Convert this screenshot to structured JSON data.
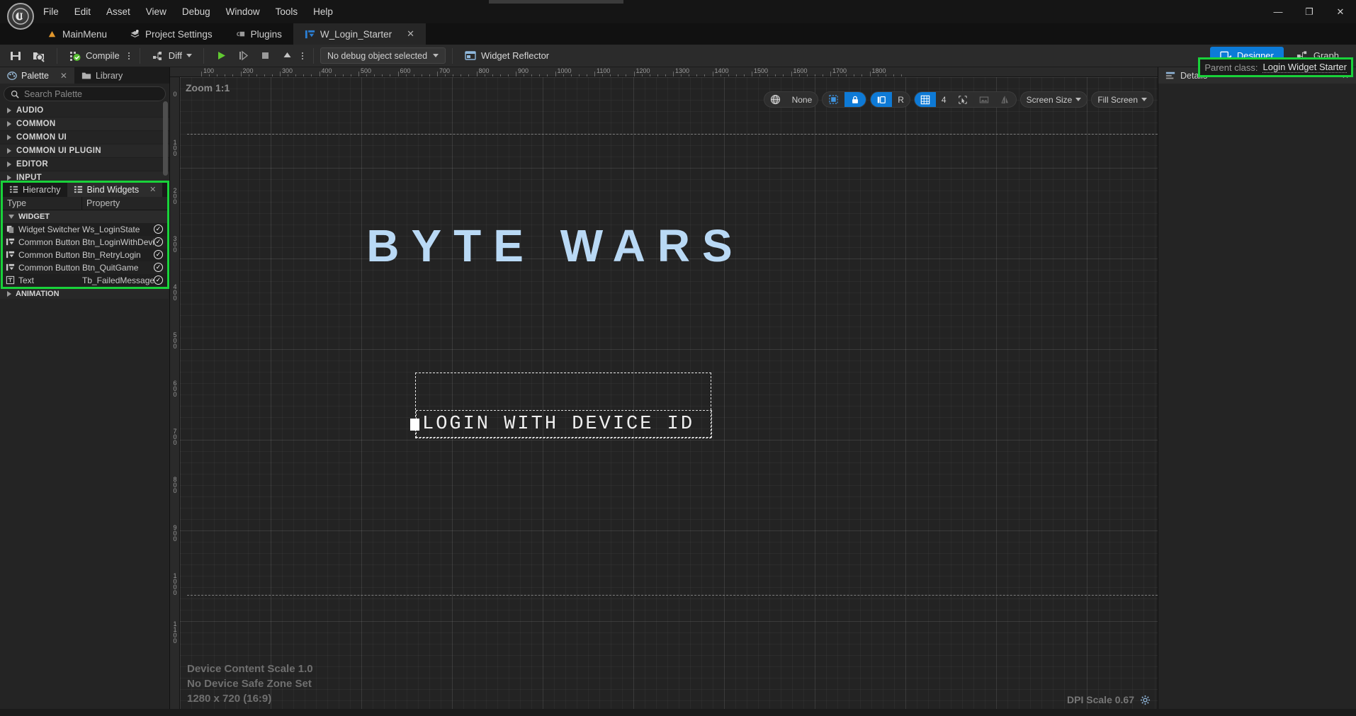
{
  "window": {
    "minimize_label": "—",
    "maximize_label": "❐",
    "close_label": "✕"
  },
  "menubar": {
    "items": [
      {
        "label": "File"
      },
      {
        "label": "Edit"
      },
      {
        "label": "Asset"
      },
      {
        "label": "View"
      },
      {
        "label": "Debug"
      },
      {
        "label": "Window"
      },
      {
        "label": "Tools"
      },
      {
        "label": "Help"
      }
    ]
  },
  "tabs": [
    {
      "label": "MainMenu",
      "icon": "level-icon",
      "active": false,
      "closable": false
    },
    {
      "label": "Project Settings",
      "icon": "settings-icon",
      "active": false,
      "closable": false
    },
    {
      "label": "Plugins",
      "icon": "plugin-icon",
      "active": false,
      "closable": false
    },
    {
      "label": "W_Login_Starter",
      "icon": "widget-blueprint-icon",
      "active": true,
      "closable": true,
      "close_label": "✕"
    }
  ],
  "toolbar": {
    "save_icon": "save-icon",
    "browse_icon": "browse-content-icon",
    "compile_label": "Compile",
    "compile_icon": "compile-icon",
    "diff_label": "Diff",
    "diff_icon": "diff-icon",
    "play_icon": "play-icon",
    "step_icon": "step-icon",
    "stop_icon": "stop-icon",
    "eject_icon": "eject-icon",
    "debug_object_label": "No debug object selected",
    "widget_reflector_label": "Widget Reflector",
    "widget_reflector_icon": "widget-reflector-icon",
    "designer_label": "Designer",
    "designer_icon": "designer-icon",
    "graph_label": "Graph",
    "graph_icon": "graph-icon",
    "accent_color": "#0c7bd8"
  },
  "parent_class": {
    "label": "Parent class:",
    "value": "Login Widget Starter",
    "highlight_color": "#19d23a"
  },
  "palette": {
    "tabs": [
      {
        "label": "Palette",
        "icon": "palette-icon",
        "active": true,
        "close_label": "✕"
      },
      {
        "label": "Library",
        "icon": "folder-icon",
        "active": false
      }
    ],
    "search_placeholder": "Search Palette",
    "search_value": "",
    "categories": [
      {
        "label": "AUDIO"
      },
      {
        "label": "COMMON"
      },
      {
        "label": "COMMON UI"
      },
      {
        "label": "COMMON UI PLUGIN"
      },
      {
        "label": "EDITOR"
      },
      {
        "label": "INPUT"
      }
    ],
    "animation_label": "ANIMATION"
  },
  "bind_widgets": {
    "highlight_color": "#19d23a",
    "tabs": [
      {
        "label": "Hierarchy",
        "icon": "hierarchy-icon",
        "active": false
      },
      {
        "label": "Bind Widgets",
        "icon": "bind-widgets-icon",
        "active": true,
        "close_label": "✕"
      }
    ],
    "columns": {
      "type": "Type",
      "property": "Property"
    },
    "group_label": "WIDGET",
    "rows": [
      {
        "type": "Widget Switcher",
        "property": "Ws_LoginState",
        "icon": "widget-switcher-icon",
        "bound": true,
        "check": "✓"
      },
      {
        "type": "Common Button Ba",
        "property": "Btn_LoginWithDeviceId",
        "icon": "common-button-icon",
        "bound": true,
        "check": "✓"
      },
      {
        "type": "Common Button Ba",
        "property": "Btn_RetryLogin",
        "icon": "common-button-icon",
        "bound": true,
        "check": "✓"
      },
      {
        "type": "Common Button Ba",
        "property": "Btn_QuitGame",
        "icon": "common-button-icon",
        "bound": true,
        "check": "✓"
      },
      {
        "type": "Text",
        "property": "Tb_FailedMessage",
        "icon": "text-icon",
        "bound": true,
        "check": "✓"
      }
    ]
  },
  "viewport": {
    "zoom_label": "Zoom 1:1",
    "ruler_top_ticks": [
      "100",
      "200",
      "300",
      "400",
      "500",
      "600",
      "700",
      "800",
      "900",
      "1000",
      "1100",
      "1200",
      "1300",
      "1400",
      "1500",
      "1600",
      "1700",
      "1800"
    ],
    "ruler_left_ticks": [
      "0",
      "1 0 0",
      "2 0 0",
      "3 0 0",
      "4 0 0",
      "5 0 0",
      "6 0 0",
      "7 0 0",
      "8 0 0",
      "9 0 0",
      "1 0 0 0",
      "1 1 0 0"
    ],
    "logo_text": "BYTE WARS",
    "selected_button_text": "LOGIN WITH DEVICE ID",
    "footer_lines": [
      "Device Content Scale 1.0",
      "No Device Safe Zone Set",
      "1280 x 720 (16:9)"
    ],
    "dpi_scale_label": "DPI Scale 0.67",
    "dpi_gear_icon": "gear-icon",
    "toolbar": {
      "snap_mode_label": "None",
      "globe_icon": "globe-icon",
      "selection_icon": "selection-outline-icon",
      "lock_icon": "lock-icon",
      "layout_icon": "layout-icon",
      "rotation_label": "R",
      "grid_icon": "grid-icon",
      "grid_value": "4",
      "cursor_icon": "cursor-snap-icon",
      "image_icon": "image-snap-icon",
      "mirror_icon": "mirror-icon",
      "screen_size_label": "Screen Size",
      "fill_screen_label": "Fill Screen"
    }
  },
  "details": {
    "tab_label": "Details",
    "tab_icon": "details-icon",
    "close_label": "✕"
  }
}
